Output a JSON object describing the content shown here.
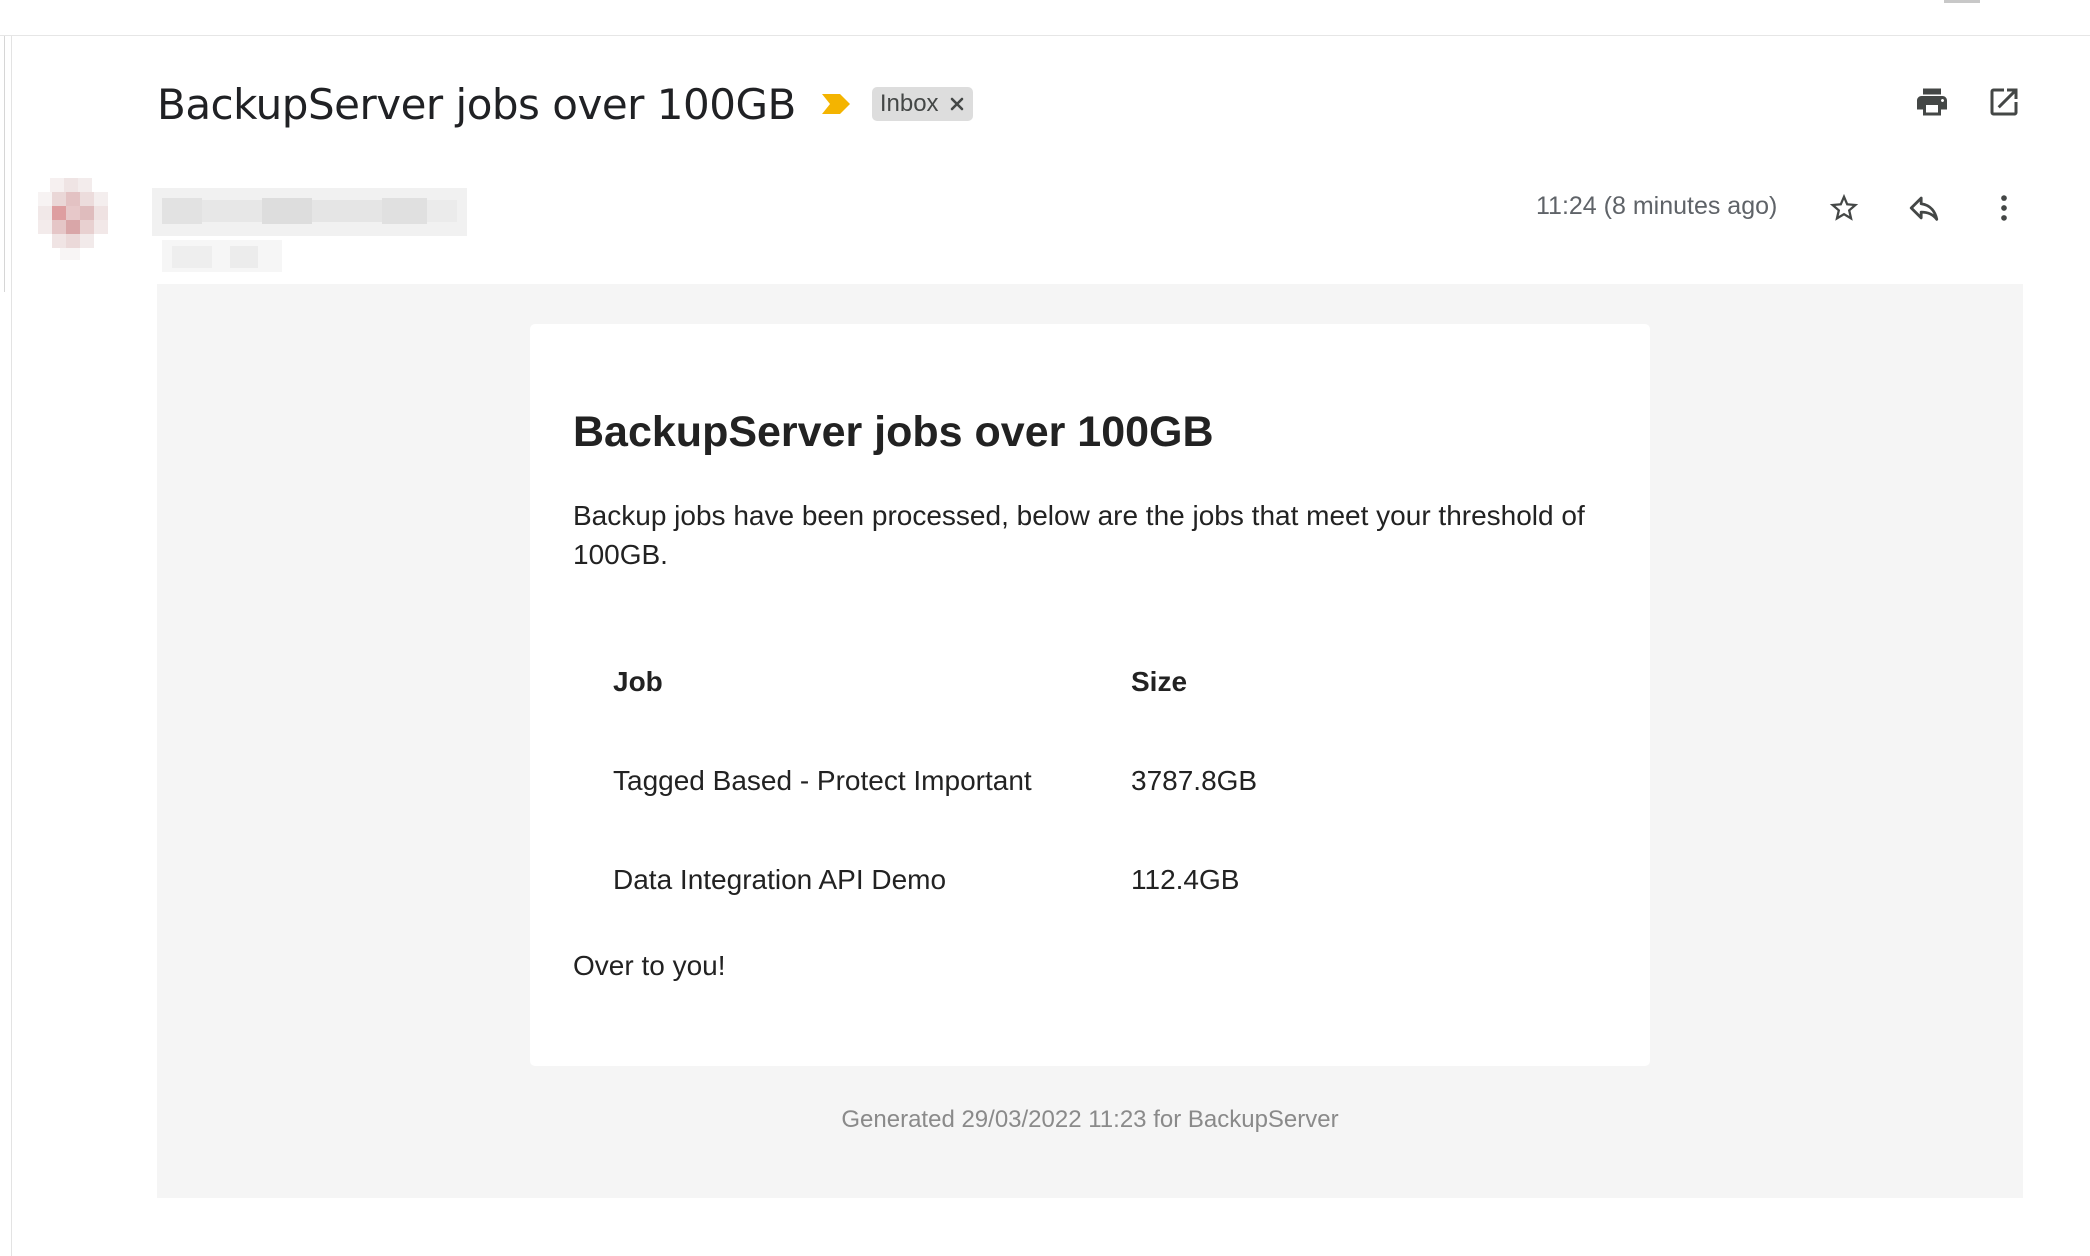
{
  "thread": {
    "subject": "BackupServer jobs over 100GB",
    "label": "Inbox",
    "importance_color": "#f4b400"
  },
  "toolbar": {
    "print_icon": "print-icon",
    "open_new_window_icon": "open-in-new-window-icon"
  },
  "message": {
    "timestamp": "11:24 (8 minutes ago)",
    "star_icon": "star-icon",
    "reply_icon": "reply-icon",
    "more_icon": "more-vertical-icon"
  },
  "email": {
    "title": "BackupServer jobs over 100GB",
    "intro": "Backup jobs have been processed, below are the jobs that meet your threshold of 100GB.",
    "table": {
      "headers": [
        "Job",
        "Size"
      ],
      "rows": [
        [
          "Tagged Based - Protect Important",
          "3787.8GB"
        ],
        [
          "Data Integration API Demo",
          "112.4GB"
        ]
      ]
    },
    "outro": "Over to you!",
    "footer": "Generated 29/03/2022 11:23 for BackupServer"
  }
}
